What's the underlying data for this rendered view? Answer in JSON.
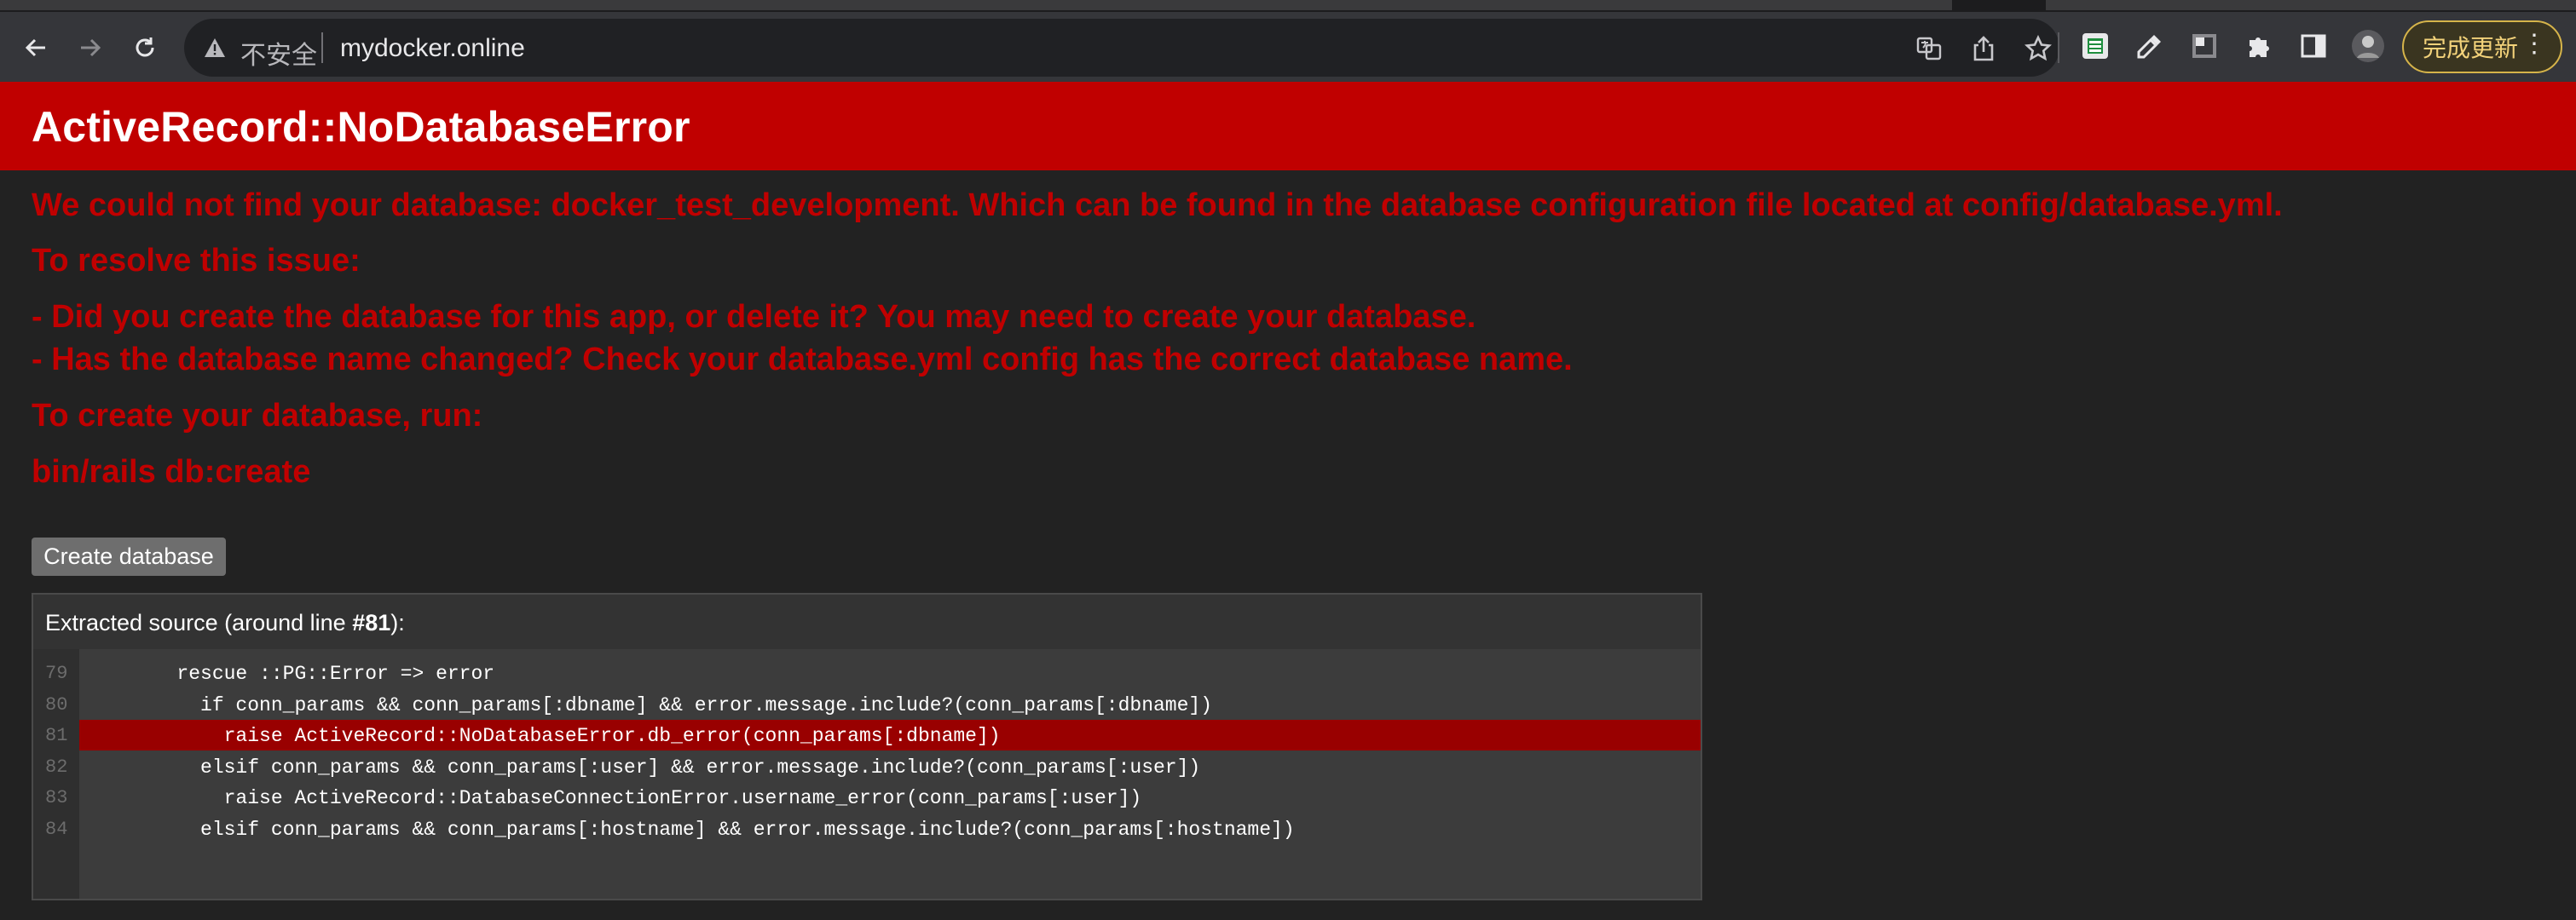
{
  "browser": {
    "security_label": "不安全",
    "url": "mydocker.online",
    "update_button_label": "完成更新",
    "menu_glyph": "⋮",
    "icons": [
      "back-icon",
      "forward-icon",
      "reload-icon",
      "warning-icon",
      "translate-icon",
      "share-icon",
      "bookmark-star-icon",
      "sheets-extension-icon",
      "eyedropper-extension-icon",
      "extension-icon",
      "puzzle-extensions-icon",
      "side-panel-icon",
      "profile-avatar"
    ]
  },
  "page": {
    "title": "ActiveRecord::NoDatabaseError",
    "message": "We could not find your database: docker_test_development. Which can be found in the database configuration file located at config/database.yml.",
    "resolve_heading": "To resolve this issue:",
    "hint_1": "- Did you create the database for this app, or delete it? You may need to create your database.",
    "hint_2": "- Has the database name changed? Check your database.yml config has the correct database name.",
    "create_heading": "To create your database, run:",
    "command": "bin/rails db:create",
    "create_button_label": "Create database"
  },
  "source": {
    "title_prefix": "Extracted source (around line ",
    "title_line": "#81",
    "title_suffix": "):",
    "highlight_line": "81",
    "lines": [
      {
        "num": "79",
        "code": "        rescue ::PG::Error => error"
      },
      {
        "num": "80",
        "code": "          if conn_params && conn_params[:dbname] && error.message.include?(conn_params[:dbname])"
      },
      {
        "num": "81",
        "code": "            raise ActiveRecord::NoDatabaseError.db_error(conn_params[:dbname])"
      },
      {
        "num": "82",
        "code": "          elsif conn_params && conn_params[:user] && error.message.include?(conn_params[:user])"
      },
      {
        "num": "83",
        "code": "            raise ActiveRecord::DatabaseConnectionError.username_error(conn_params[:user])"
      },
      {
        "num": "84",
        "code": "          elsif conn_params && conn_params[:hostname] && error.message.include?(conn_params[:hostname])"
      }
    ]
  },
  "colors": {
    "header_bg": "#c00000",
    "error_text": "#c00000",
    "highlight_bg": "#990000",
    "page_bg": "#222222"
  }
}
